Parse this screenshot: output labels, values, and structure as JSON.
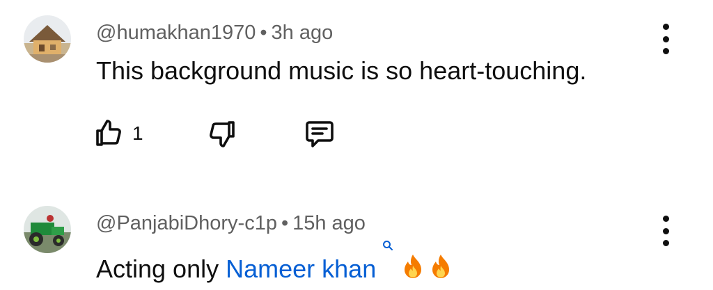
{
  "comments": [
    {
      "handle": "@humakhan1970",
      "separator": "•",
      "time": "3h ago",
      "text": "This background music is so heart-touching.",
      "likes": "1"
    },
    {
      "handle": "@PanjabiDhory-c1p",
      "separator": "•",
      "time": "15h ago",
      "text_prefix": "Acting only ",
      "mention": "Nameer khan",
      "mention_icon": "search-icon",
      "emojis": [
        "fire-emoji",
        "fire-emoji"
      ]
    }
  ],
  "colors": {
    "meta": "#606060",
    "text": "#0f0f0f",
    "mention": "#065fd4"
  }
}
